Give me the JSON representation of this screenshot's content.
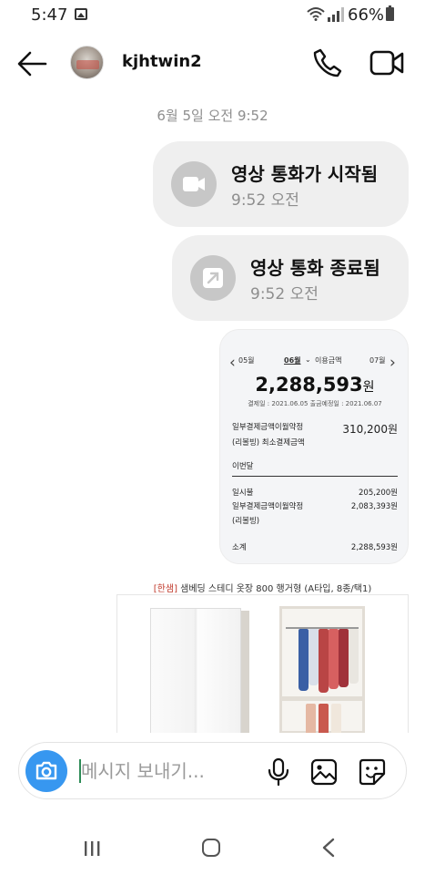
{
  "status_bar": {
    "time": "5:47",
    "battery": "66%",
    "icons": [
      "gallery-notification-icon",
      "wifi-icon",
      "signal-icon",
      "battery-icon"
    ]
  },
  "header": {
    "username": "kjhtwin2",
    "icons": [
      "back-arrow-icon",
      "avatar",
      "phone-icon",
      "video-camera-icon"
    ]
  },
  "thread": {
    "date_label": "6월 5일 오전 9:52",
    "call_started": {
      "title": "영상 통화가 시작됨",
      "time": "9:52 오전"
    },
    "call_ended": {
      "title": "영상 통화 종료됨",
      "time": "9:52 오전"
    },
    "shared_screenshot": {
      "prev_month": "05월",
      "current_month": "06월",
      "current_month_label": "이용금액",
      "next_month": "07월",
      "amount": "2,288,593",
      "amount_unit": "원",
      "dates": "결제일 : 2021.06.05    출금예정일 : 2021.06.07",
      "revolving_label_1": "일부결제금액이월약정",
      "revolving_label_2": "(리볼빙) 최소결제금액",
      "revolving_value": "310,200원",
      "section_label": "이번달",
      "item1_label": "일시불",
      "item1_value": "205,200원",
      "item2_label_1": "일부결제금액이월약정",
      "item2_label_2": "(리볼빙)",
      "item2_value": "2,083,393원",
      "total_label": "소계",
      "total_value": "2,288,593원"
    },
    "product": {
      "title_brand": "[한샘]",
      "title_rest": " 샘베딩 스테디 옷장 800 행거형 (A타입, 8종/택1)"
    }
  },
  "composer": {
    "placeholder": "메시지 보내기...",
    "icons": [
      "camera-icon",
      "microphone-icon",
      "image-icon",
      "sticker-icon"
    ]
  },
  "colors": {
    "accent": "#3797f0",
    "bubble": "#efefef",
    "muted_text": "#8e8e8e"
  }
}
